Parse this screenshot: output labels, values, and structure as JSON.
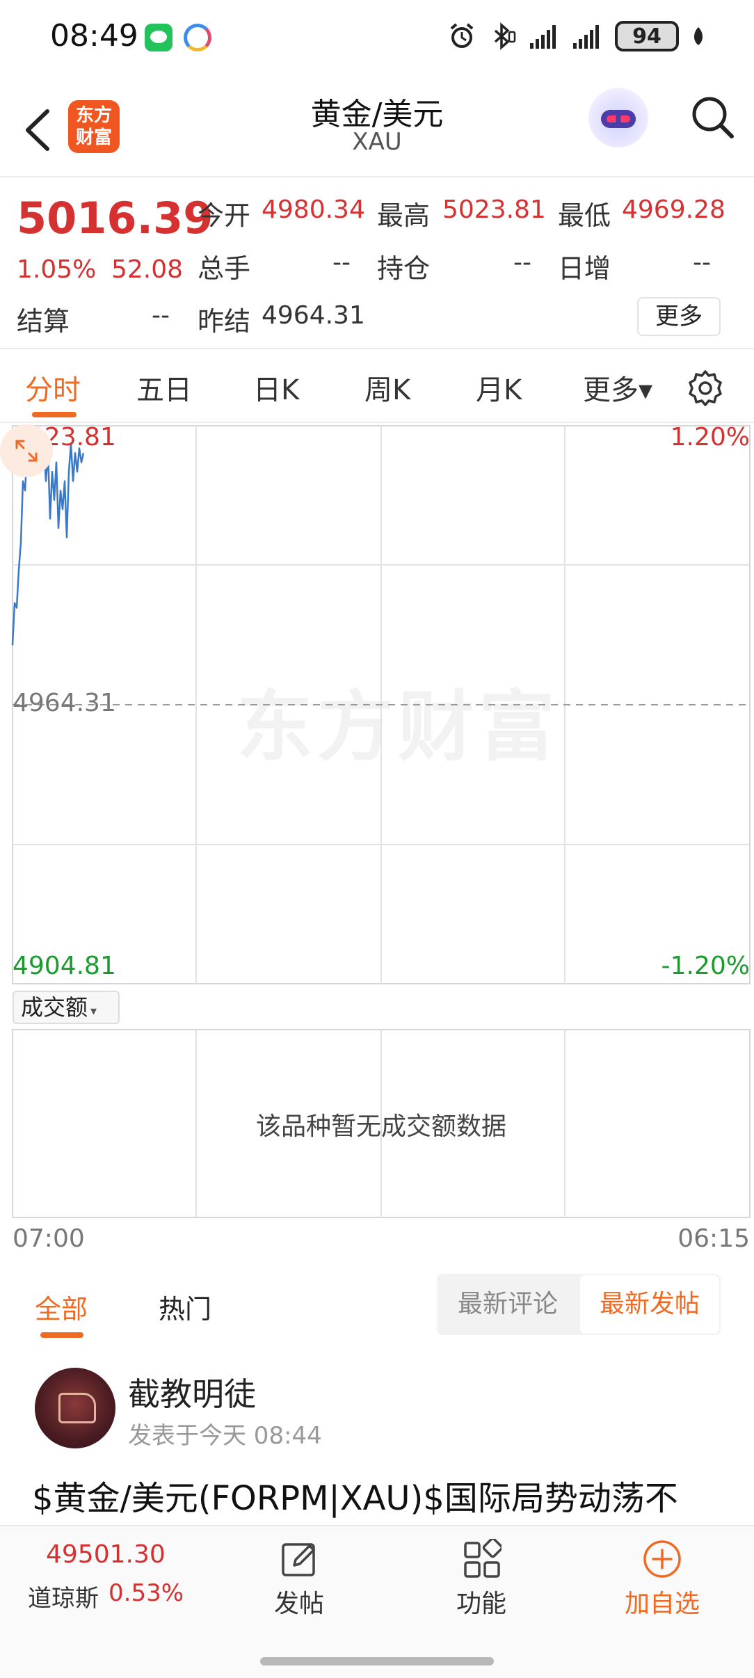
{
  "status_bar": {
    "time": "08:49",
    "battery": "94",
    "icons": [
      "wechat-icon",
      "app-circle-icon",
      "alarm-icon",
      "bluetooth-icon",
      "signal-icon",
      "signal-icon",
      "leaf-icon"
    ]
  },
  "header": {
    "logo_line1": "东方",
    "logo_line2": "财富",
    "title": "黄金/美元",
    "subtitle": "XAU"
  },
  "quote": {
    "price": "5016.39",
    "change_pct": "1.05%",
    "change": "52.08",
    "open_label": "今开",
    "open": "4980.34",
    "high_label": "最高",
    "high": "5023.81",
    "low_label": "最低",
    "low": "4969.28",
    "volume_label": "总手",
    "volume": "--",
    "position_label": "持仓",
    "position": "--",
    "daily_inc_label": "日增",
    "daily_inc": "--",
    "settle_label": "结算",
    "settle": "--",
    "prev_settle_label": "昨结",
    "prev_settle": "4964.31",
    "more_label": "更多"
  },
  "tabs": [
    "分时",
    "五日",
    "日K",
    "周K",
    "月K",
    "更多▾"
  ],
  "chart": {
    "watermark": "东方财富",
    "y_top": "5023.81",
    "y_mid": "4964.31",
    "y_bottom": "4904.81",
    "pct_top": "1.20%",
    "pct_bottom": "-1.20%",
    "volume_selector": "成交额",
    "volume_arrow": "▾",
    "no_data": "该品种暂无成交额数据",
    "x_start": "07:00",
    "x_end": "06:15"
  },
  "chart_data": {
    "type": "line",
    "title": "",
    "x": [
      0,
      1,
      2,
      3,
      4,
      5,
      6,
      7,
      8,
      9,
      10,
      11,
      12,
      13,
      14,
      15,
      16,
      17,
      18,
      19,
      20,
      21,
      22,
      23,
      24,
      25,
      26,
      27,
      28,
      29,
      30,
      31,
      32,
      33,
      34
    ],
    "series": [
      {
        "values": [
          4977,
          4986,
          4985,
          4993,
          4999,
          5012,
          5010,
          5018,
          5015,
          5021,
          5016,
          5022,
          5019,
          5023,
          5017,
          5020,
          5012,
          5018,
          5004,
          5014,
          5008,
          5016,
          5002,
          5010,
          5006,
          5012,
          5000,
          5014,
          5020,
          5012,
          5018,
          5014,
          5019,
          5016,
          5018
        ]
      }
    ],
    "ylim": [
      4904.81,
      5023.81
    ],
    "reference_line": 4964.31,
    "x_tick_labels": [
      "07:00",
      "06:15"
    ],
    "y_tick_labels": [
      "5023.81",
      "4964.31",
      "4904.81"
    ],
    "right_tick_labels": [
      "1.20%",
      "-1.20%"
    ],
    "line_color": "#3a78c9",
    "grid": true
  },
  "feed": {
    "tab_all": "全部",
    "tab_hot": "热门",
    "sort_comment": "最新评论",
    "sort_post": "最新发帖"
  },
  "post": {
    "author": "截教明徒",
    "time": "发表于今天 08:44",
    "text": "$黄金/美元(FORPM|XAU)$国际局势动荡不"
  },
  "bottom_bar": {
    "index_value": "49501.30",
    "index_name": "道琼斯",
    "index_pct": "0.53%",
    "post_label": "发帖",
    "func_label": "功能",
    "add_label": "加自选"
  },
  "colors": {
    "accent": "#ef6a22",
    "up": "#d63131",
    "down": "#1a9b2e",
    "line": "#3a78c9"
  }
}
